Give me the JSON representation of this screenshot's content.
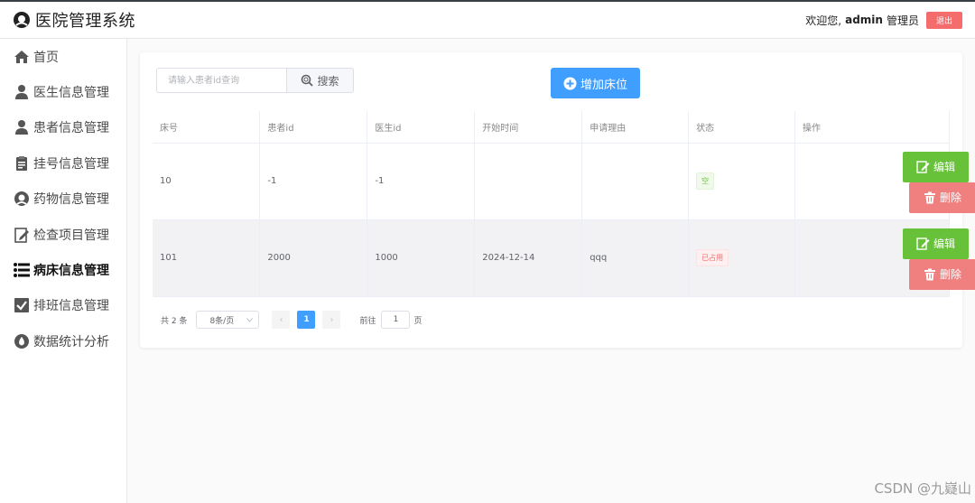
{
  "header": {
    "title": "医院管理系统",
    "welcome": "欢迎您,",
    "username": "admin",
    "role": "管理员",
    "logout_label": "退出"
  },
  "sidebar": {
    "items": [
      {
        "label": "首页",
        "icon": "home-icon"
      },
      {
        "label": "医生信息管理",
        "icon": "user-icon"
      },
      {
        "label": "患者信息管理",
        "icon": "user-icon"
      },
      {
        "label": "挂号信息管理",
        "icon": "clipboard-icon"
      },
      {
        "label": "药物信息管理",
        "icon": "nurse-icon"
      },
      {
        "label": "检查项目管理",
        "icon": "edit-doc-icon"
      },
      {
        "label": "病床信息管理",
        "icon": "list-icon",
        "active": true
      },
      {
        "label": "排班信息管理",
        "icon": "check-box-icon"
      },
      {
        "label": "数据统计分析",
        "icon": "drop-icon"
      }
    ]
  },
  "toolbar": {
    "search_placeholder": "请输入患者id查询",
    "search_label": "搜索",
    "add_label": "增加床位"
  },
  "table": {
    "headers": [
      "床号",
      "患者id",
      "医生id",
      "开始时间",
      "申请理由",
      "状态",
      "操作"
    ],
    "rows": [
      {
        "bed": "10",
        "patient": "-1",
        "doctor": "-1",
        "start": "",
        "reason": "",
        "status": "空"
      },
      {
        "bed": "101",
        "patient": "2000",
        "doctor": "1000",
        "start": "2024-12-14",
        "reason": "qqq",
        "status": "已占用"
      }
    ],
    "edit_label": "编辑",
    "delete_label": "删除"
  },
  "pagination": {
    "total": "共 2 条",
    "page_size": "8条/页",
    "prev": "‹",
    "current": "1",
    "next": "›",
    "goto_label": "前往",
    "goto_value": "1",
    "goto_suffix": "页"
  },
  "watermark": "CSDN @九嶷山",
  "colors": {
    "primary": "#409eff",
    "success": "#67c23a",
    "danger": "#f56c6c"
  }
}
